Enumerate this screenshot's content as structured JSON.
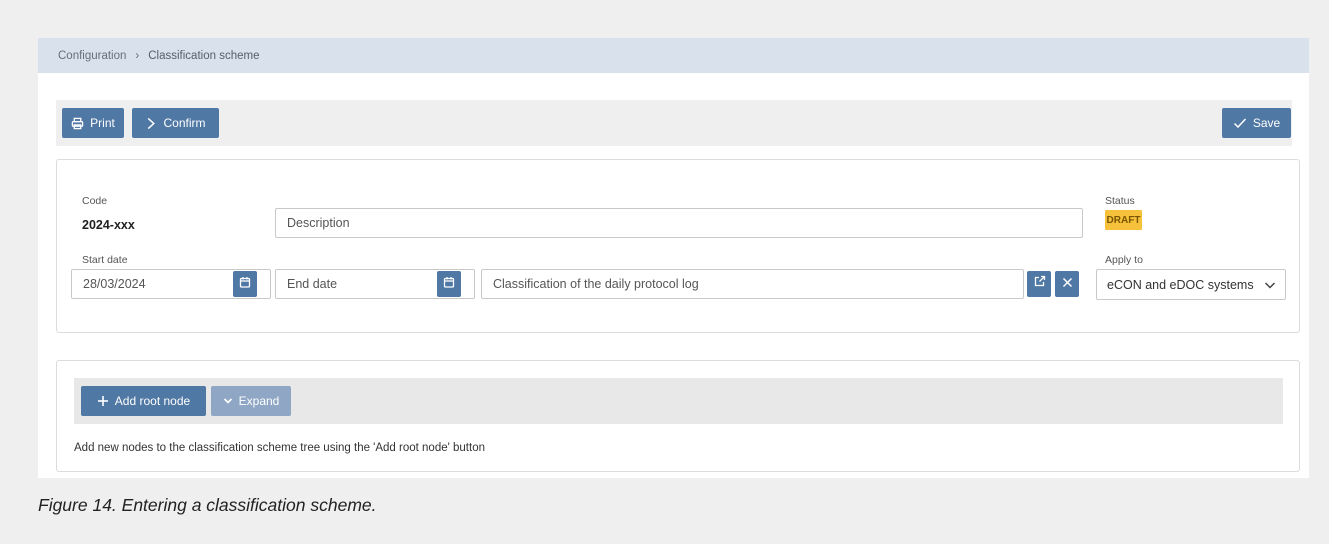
{
  "breadcrumb": {
    "parent": "Configuration",
    "separator": "›",
    "current": "Classification scheme"
  },
  "toolbar": {
    "print_label": "Print",
    "confirm_label": "Confirm",
    "save_label": "Save"
  },
  "form": {
    "code_label": "Code",
    "code_value": "2024-xxx",
    "description_placeholder": "Description",
    "status_label": "Status",
    "status_value": "DRAFT",
    "start_date_label": "Start date",
    "start_date_value": "28/03/2024",
    "end_date_placeholder": "End date",
    "linked_value": "Classification of the daily protocol log",
    "apply_to_label": "Apply to",
    "apply_to_value": "eCON and eDOC systems"
  },
  "tree": {
    "add_root_label": "Add root node",
    "expand_label": "Expand",
    "hint": "Add new nodes to the classification scheme tree using the 'Add root node' button"
  },
  "caption": "Figure 14. Entering a classification scheme.",
  "colors": {
    "primary_button": "#4f78a4",
    "disabled_button": "#8fa7c4",
    "breadcrumb_bg": "#d8e1ec",
    "draft_badge": "#f7c23b"
  },
  "icons": {
    "print": "printer-icon",
    "confirm": "chevron-right-icon",
    "save": "checkmark-icon",
    "calendar": "calendar-icon",
    "open_link": "external-link-icon",
    "clear": "close-icon",
    "dropdown": "chevron-down-icon",
    "add": "plus-icon",
    "expand": "chevron-down-icon"
  }
}
